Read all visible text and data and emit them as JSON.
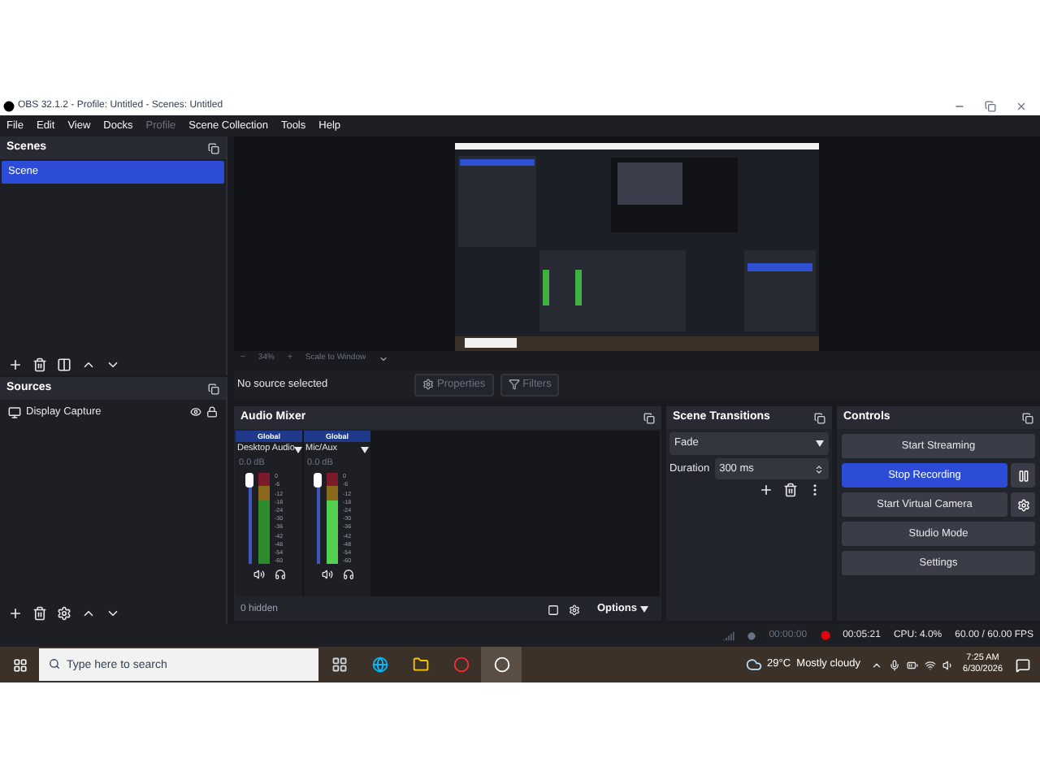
{
  "window": {
    "title": "OBS 32.1.2 - Profile: Untitled - Scenes: Untitled"
  },
  "menu": [
    {
      "label": "File",
      "disabled": false
    },
    {
      "label": "Edit",
      "disabled": false
    },
    {
      "label": "View",
      "disabled": false
    },
    {
      "label": "Docks",
      "disabled": false
    },
    {
      "label": "Profile",
      "disabled": true
    },
    {
      "label": "Scene Collection",
      "disabled": false
    },
    {
      "label": "Tools",
      "disabled": false
    },
    {
      "label": "Help",
      "disabled": false
    }
  ],
  "scenes": {
    "title": "Scenes",
    "items": [
      {
        "label": "Scene",
        "selected": true
      }
    ]
  },
  "preview": {
    "kind": "picture",
    "zoom_bar": [
      "−",
      "34%",
      "+",
      "Scale to Window"
    ]
  },
  "sources": {
    "title": "Sources",
    "items": [
      {
        "label": "Display Capture",
        "selected": false
      }
    ]
  },
  "source_toolbar": {
    "status": "No source selected",
    "buttons": [
      "Properties",
      "Filters"
    ]
  },
  "audio_mixer": {
    "title": "Audio Mixer",
    "channels": [
      {
        "badge": "Global",
        "name": "Desktop Audio",
        "reading": "0.0 dB",
        "level": 1,
        "ticks": [
          "0",
          "-6",
          "-12",
          "-18",
          "-24",
          "-30",
          "-36",
          "-42",
          "-48",
          "-54",
          "-60"
        ]
      },
      {
        "badge": "Global",
        "name": "Mic/Aux",
        "reading": "0.0 dB",
        "level": 1,
        "ticks": [
          "0",
          "-6",
          "-12",
          "-18",
          "-24",
          "-30",
          "-36",
          "-42",
          "-48",
          "-54",
          "-60"
        ]
      }
    ],
    "hidden": "0 hidden",
    "options": "Options"
  },
  "scene_transitions": {
    "title": "Scene Transitions",
    "transition": "Fade",
    "duration_label": "Duration",
    "duration": "300 ms"
  },
  "controls": {
    "title": "Controls",
    "buttons": [
      {
        "label": "Start Streaming",
        "active": false,
        "kind": "plain"
      },
      {
        "label": "Stop Recording",
        "active": true,
        "kind": "pause"
      },
      {
        "label": "Start Virtual Camera",
        "active": false,
        "kind": "gear"
      },
      {
        "label": "Studio Mode",
        "active": false,
        "kind": "plain"
      },
      {
        "label": "Settings",
        "active": false,
        "kind": "plain"
      }
    ]
  },
  "status_bar": {
    "stream_time": "00:00:00",
    "record_time": "00:05:21",
    "cpu": "CPU: 4.0%",
    "fps": "60.00 / 60.00 FPS"
  },
  "taskbar": {
    "search_placeholder": "Type here to search",
    "apps": [
      {
        "kind": "taskview",
        "selected": false
      },
      {
        "kind": "edge",
        "selected": false
      },
      {
        "kind": "folder",
        "selected": false
      },
      {
        "kind": "chrome",
        "selected": false
      },
      {
        "kind": "obs",
        "selected": true
      }
    ],
    "weather": "29°C  Mostly cloudy",
    "time": "7:25 AM",
    "date": "6/30/2026"
  }
}
